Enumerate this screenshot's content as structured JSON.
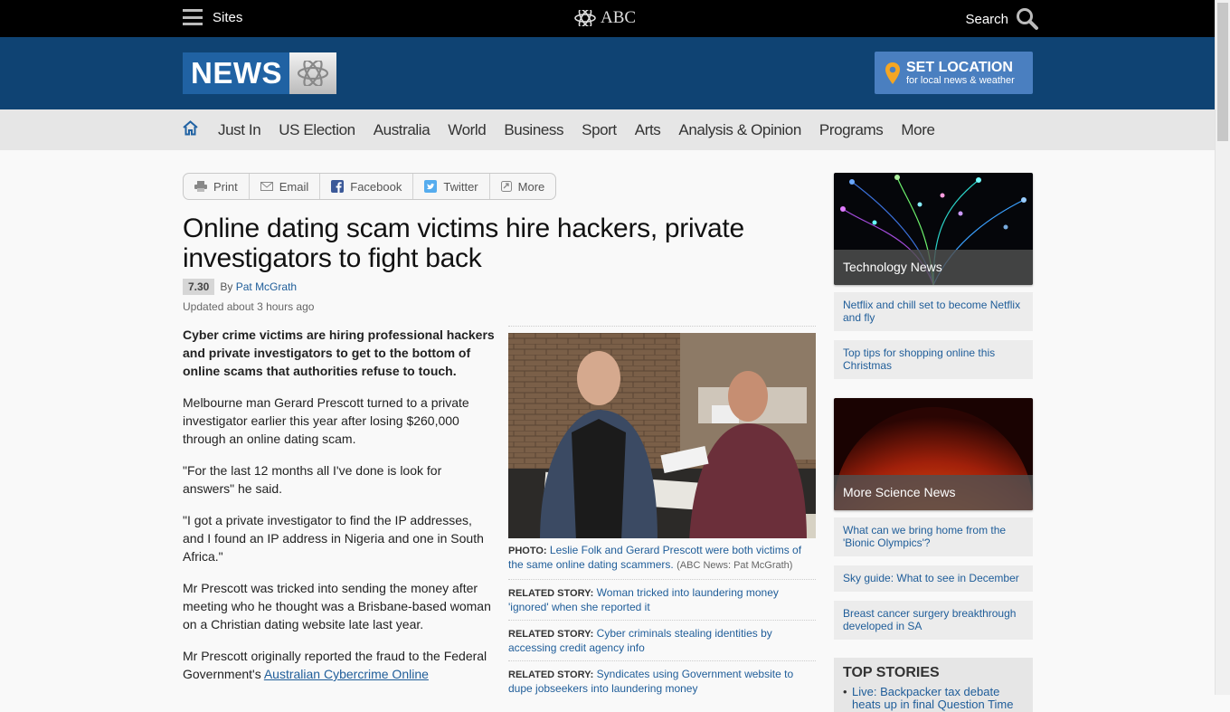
{
  "topbar": {
    "sites_label": "Sites",
    "logo_text": "ABC",
    "search_label": "Search"
  },
  "header": {
    "news_logo": "NEWS",
    "set_location": {
      "title": "SET LOCATION",
      "subtitle": "for local news & weather"
    }
  },
  "nav": {
    "items": [
      "Just In",
      "US Election",
      "Australia",
      "World",
      "Business",
      "Sport",
      "Arts",
      "Analysis & Opinion",
      "Programs",
      "More"
    ]
  },
  "share": {
    "print": "Print",
    "email": "Email",
    "facebook": "Facebook",
    "twitter": "Twitter",
    "more": "More"
  },
  "article": {
    "headline": "Online dating scam victims hire hackers, private investigators to fight back",
    "program_tag": "7.30",
    "by": "By",
    "author": "Pat McGrath",
    "updated": "Updated about 3 hours ago",
    "lead": "Cyber crime victims are hiring professional hackers and private investigators to get to the bottom of online scams that authorities refuse to touch.",
    "paragraphs": [
      "Melbourne man Gerard Prescott turned to a private investigator earlier this year after losing $260,000 through an online dating scam.",
      "\"For the last 12 months all I've done is look for answers\" he said.",
      "\"I got a private investigator to find the IP addresses, and I found an IP address in Nigeria and one in South Africa.\"",
      "Mr Prescott was tricked into sending the money after meeting who he thought was a Brisbane-based woman on a Christian dating website late last year."
    ],
    "last_para_start": "Mr Prescott originally reported the fraud to the Federal Government's ",
    "last_para_link": "Australian Cybercrime Online",
    "photo": {
      "label": "PHOTO:",
      "caption": "Leslie Folk and Gerard Prescott were both victims of the same online dating scammers.",
      "credit": "(ABC News: Pat McGrath)"
    },
    "related": [
      {
        "label": "RELATED STORY:",
        "title": "Woman tricked into laundering money 'ignored' when she reported it"
      },
      {
        "label": "RELATED STORY:",
        "title": "Cyber criminals stealing identities by accessing credit agency info"
      },
      {
        "label": "RELATED STORY:",
        "title": "Syndicates using Government website to dupe jobseekers into laundering money"
      }
    ]
  },
  "sidebar": {
    "promo1": {
      "label": "Technology News",
      "links": [
        "Netflix and chill set to become Netflix and fly",
        "Top tips for shopping online this Christmas"
      ]
    },
    "promo2": {
      "label": "More Science News",
      "links": [
        "What can we bring home from the 'Bionic Olympics'?",
        "Sky guide: What to see in December",
        "Breast cancer surgery breakthrough developed in SA"
      ]
    },
    "top_stories": {
      "title": "TOP STORIES",
      "items": [
        "Live: Backpacker tax debate heats up in final Question Time"
      ]
    }
  }
}
